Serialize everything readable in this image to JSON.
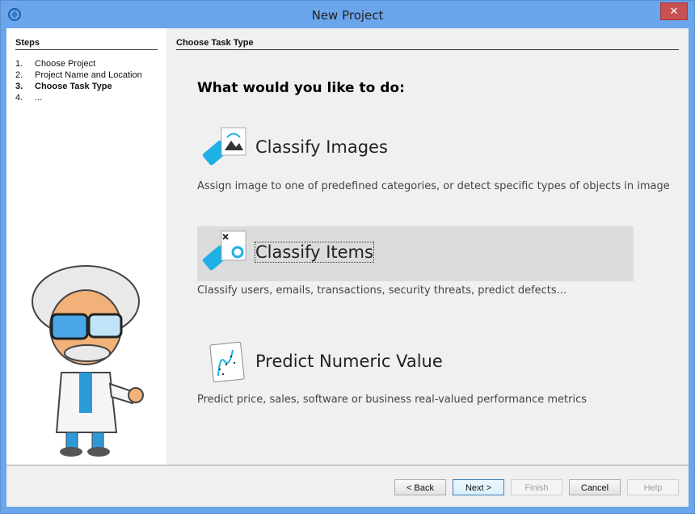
{
  "window": {
    "title": "New Project",
    "close_label": "✕"
  },
  "steps": {
    "header": "Steps",
    "items": [
      {
        "num": "1.",
        "label": "Choose Project"
      },
      {
        "num": "2.",
        "label": "Project Name and Location"
      },
      {
        "num": "3.",
        "label": "Choose Task Type"
      },
      {
        "num": "4.",
        "label": "..."
      }
    ]
  },
  "main": {
    "header": "Choose Task Type",
    "question": "What would you like to do:",
    "options": [
      {
        "label": "Classify Images",
        "description": "Assign image to one of predefined categories, or detect specific types of objects in image",
        "icon": "image-icon"
      },
      {
        "label": "Classify Items",
        "description": "Classify users, emails, transactions, security threats, predict defects...",
        "icon": "classify-items-icon"
      },
      {
        "label": "Predict Numeric Value",
        "description": "Predict price, sales, software or business real-valued performance metrics",
        "icon": "chart-icon"
      }
    ]
  },
  "buttons": {
    "back": "< Back",
    "next": "Next >",
    "finish": "Finish",
    "cancel": "Cancel",
    "help": "Help"
  }
}
